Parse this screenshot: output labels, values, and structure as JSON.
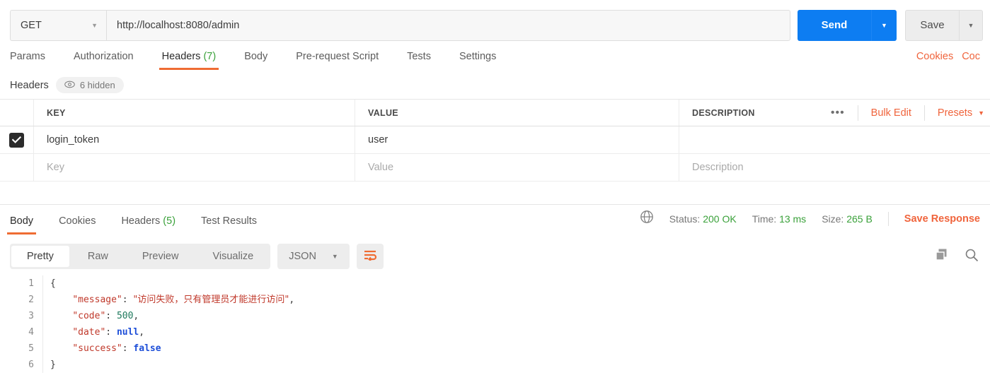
{
  "request": {
    "method": "GET",
    "url": "http://localhost:8080/admin",
    "send_label": "Send",
    "save_label": "Save",
    "tabs": [
      {
        "label": "Params",
        "count": "",
        "active": false
      },
      {
        "label": "Authorization",
        "count": "",
        "active": false
      },
      {
        "label": "Headers",
        "count": "(7)",
        "active": true
      },
      {
        "label": "Body",
        "count": "",
        "active": false
      },
      {
        "label": "Pre-request Script",
        "count": "",
        "active": false
      },
      {
        "label": "Tests",
        "count": "",
        "active": false
      },
      {
        "label": "Settings",
        "count": "",
        "active": false
      }
    ],
    "right_links": [
      "Cookies",
      "Coc"
    ],
    "headers_section": {
      "label": "Headers",
      "hidden_badge": "6 hidden",
      "columns": [
        "KEY",
        "VALUE",
        "DESCRIPTION"
      ],
      "actions": {
        "dots": "•••",
        "bulk_edit": "Bulk Edit",
        "presets": "Presets"
      },
      "rows": [
        {
          "checked": true,
          "key": "login_token",
          "value": "user",
          "description": ""
        }
      ],
      "placeholder_row": {
        "key": "Key",
        "value": "Value",
        "description": "Description"
      }
    }
  },
  "response": {
    "tabs": [
      {
        "label": "Body",
        "count": "",
        "active": true
      },
      {
        "label": "Cookies",
        "count": "",
        "active": false
      },
      {
        "label": "Headers",
        "count": "(5)",
        "active": false
      },
      {
        "label": "Test Results",
        "count": "",
        "active": false
      }
    ],
    "status_label": "Status:",
    "status_value": "200 OK",
    "time_label": "Time:",
    "time_value": "13 ms",
    "size_label": "Size:",
    "size_value": "265 B",
    "save_response": "Save Response",
    "view_modes": [
      {
        "label": "Pretty",
        "active": true
      },
      {
        "label": "Raw",
        "active": false
      },
      {
        "label": "Preview",
        "active": false
      },
      {
        "label": "Visualize",
        "active": false
      }
    ],
    "format": "JSON",
    "body_lines": [
      "1",
      "2",
      "3",
      "4",
      "5",
      "6"
    ],
    "json": {
      "message_key": "\"message\"",
      "message_value": "\"访问失败，只有管理员才能进行访问\"",
      "code_key": "\"code\"",
      "code_value": "500",
      "date_key": "\"date\"",
      "date_value": "null",
      "success_key": "\"success\"",
      "success_value": "false",
      "open_brace": "{",
      "close_brace": "}"
    }
  },
  "colors": {
    "accent_orange": "#ef6c33",
    "send_blue": "#0d7df2",
    "status_green": "#3aa13a"
  }
}
